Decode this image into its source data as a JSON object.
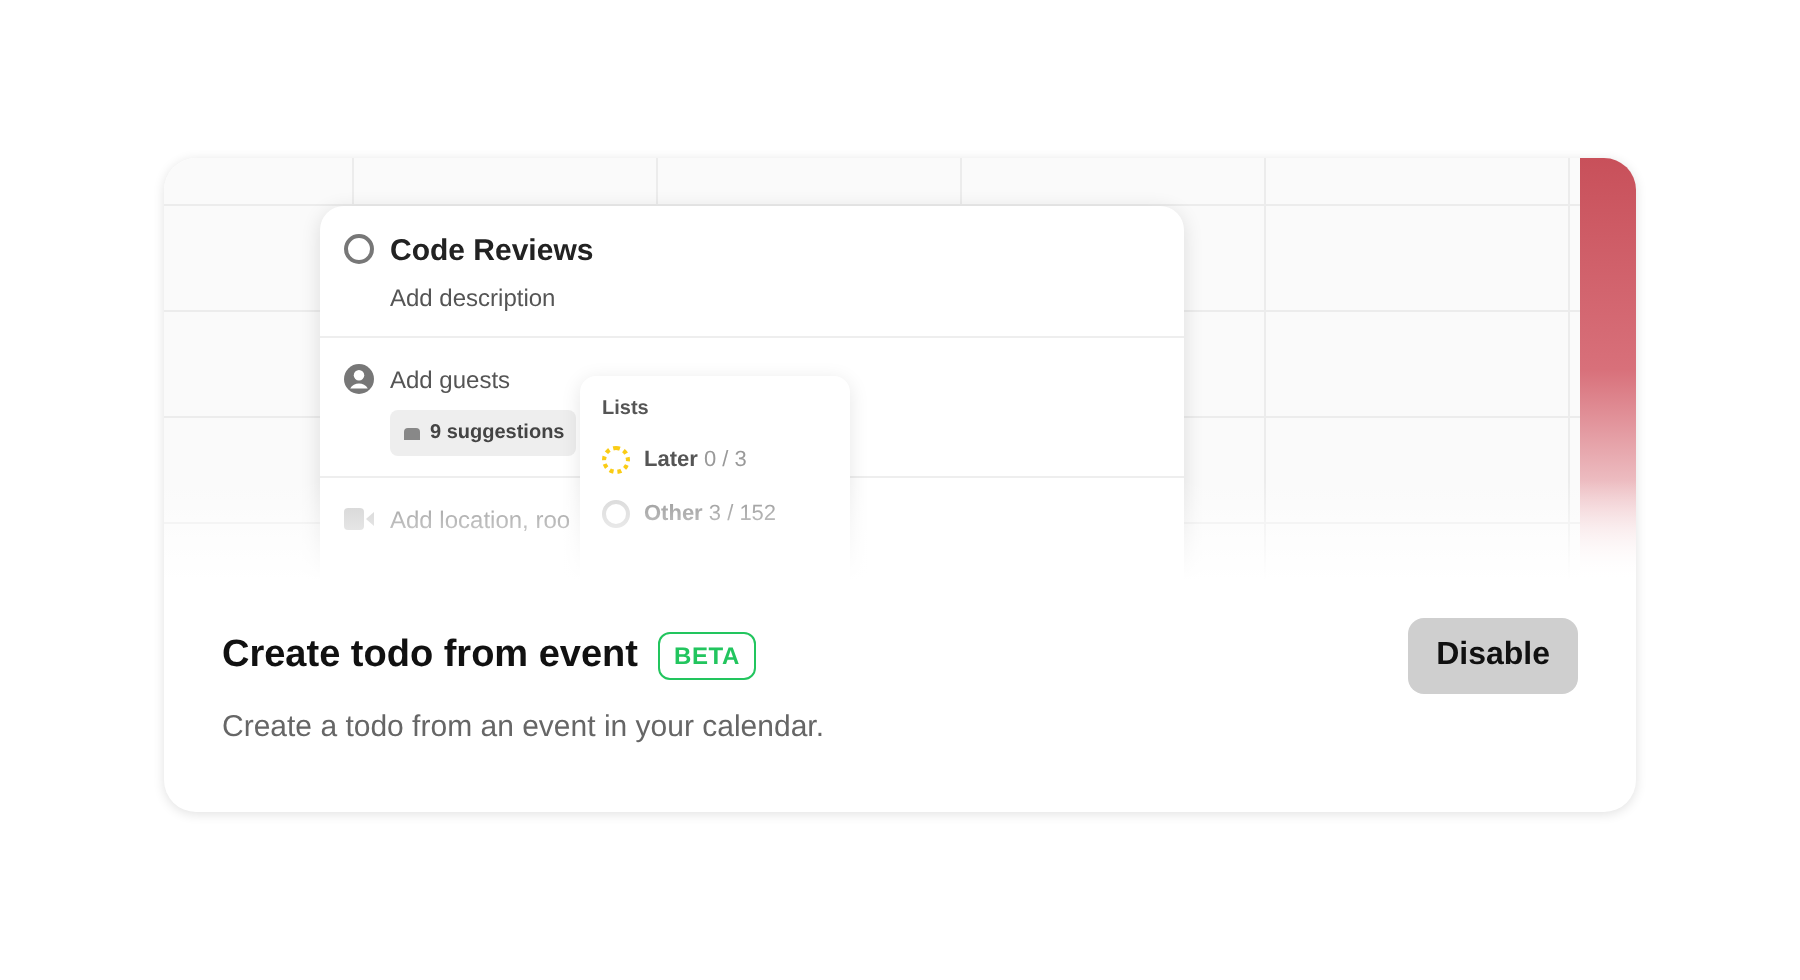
{
  "preview": {
    "task": {
      "title": "Code Reviews",
      "description": "Add description",
      "done": false
    },
    "guests": {
      "label": "Add guests",
      "suggestions": "9 suggestions"
    },
    "location": {
      "placeholder": "Add location, roo"
    },
    "lists_menu": {
      "heading": "Lists",
      "items": [
        {
          "name": "Later",
          "count": "0 / 3",
          "color": "#facc15"
        },
        {
          "name": "Other",
          "count": "3 / 152",
          "color": "#d4d4d4"
        }
      ]
    }
  },
  "feature": {
    "title": "Create todo from event",
    "badge": "BETA",
    "description": "Create a todo from an event in your calendar.",
    "button": "Disable"
  }
}
